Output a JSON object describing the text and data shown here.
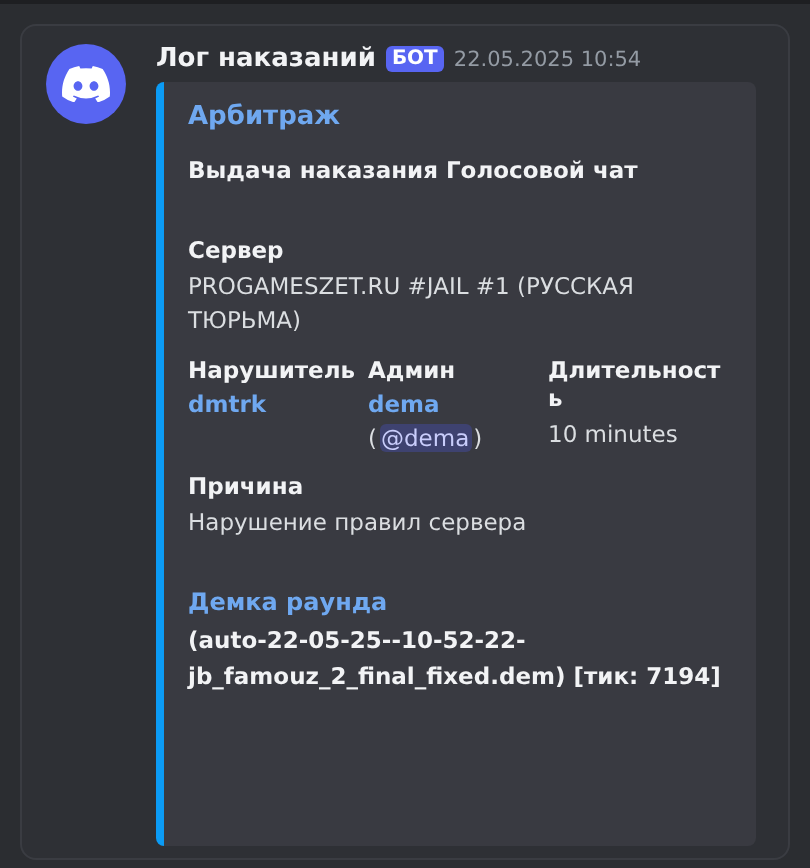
{
  "message": {
    "author": "Лог наказаний",
    "badge": "БОТ",
    "timestamp": "22.05.2025 10:54",
    "embed": {
      "title": "Арбитраж",
      "description": "Выдача наказания Голосовой чат",
      "fields": [
        {
          "kind": "block",
          "name": "Сервер",
          "value": "PROGAMESZET.RU #JAIL #1 (РУССКАЯ ТЮРЬМА)"
        },
        {
          "kind": "inline",
          "name": "Нарушитель",
          "link": "dmtrk"
        },
        {
          "kind": "inline",
          "name": "Админ",
          "link": "dema",
          "open": "(",
          "mention": "@dema",
          "close": ")"
        },
        {
          "kind": "inline",
          "name": "Длительность",
          "value": "10 minutes"
        },
        {
          "kind": "block",
          "name": "Причина",
          "value": "Нарушение правил сервера"
        },
        {
          "kind": "link",
          "name": "Демка раунда",
          "value": "(auto-22-05-25--10-52-22-jb_famouz_2_final_fixed.dem) [тик: 7194]"
        }
      ]
    }
  }
}
